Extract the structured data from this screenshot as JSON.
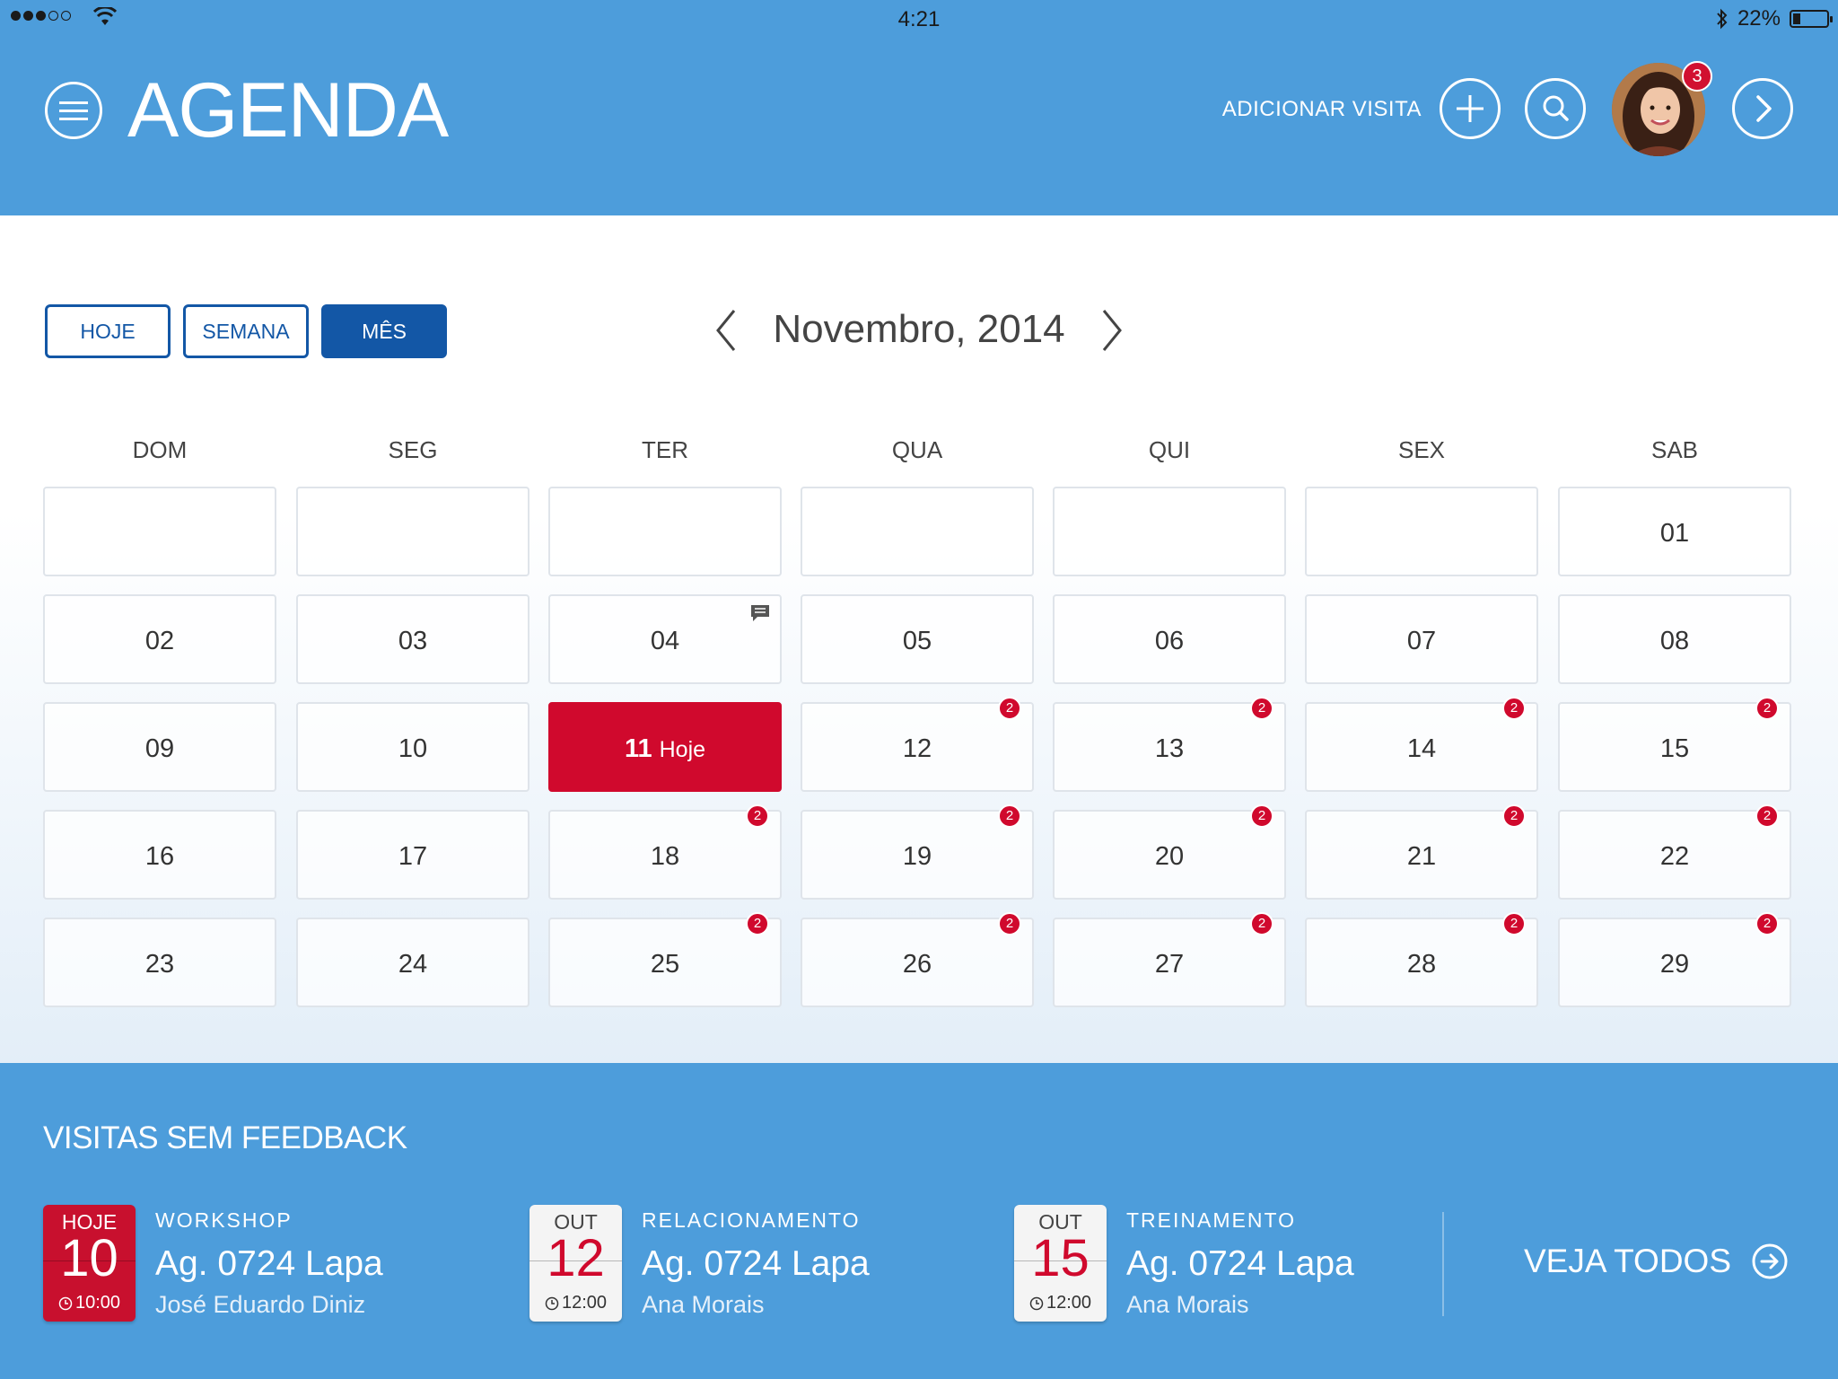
{
  "status_bar": {
    "time": "4:21",
    "battery": "22%",
    "battery_fraction": 0.22
  },
  "header": {
    "title": "AGENDA",
    "add_visit_label": "ADICIONAR VISITA",
    "notification_count": "3"
  },
  "calendar": {
    "views": [
      {
        "label": "HOJE",
        "active": false
      },
      {
        "label": "SEMANA",
        "active": false
      },
      {
        "label": "MÊS",
        "active": true
      }
    ],
    "month_label": "Novembro, 2014",
    "weekdays": [
      "DOM",
      "SEG",
      "TER",
      "QUA",
      "QUI",
      "SEX",
      "SAB"
    ],
    "today_label": "Hoje",
    "weeks": [
      [
        null,
        null,
        null,
        null,
        null,
        null,
        {
          "num": "01"
        }
      ],
      [
        {
          "num": "02"
        },
        {
          "num": "03"
        },
        {
          "num": "04",
          "comment": true
        },
        {
          "num": "05"
        },
        {
          "num": "06"
        },
        {
          "num": "07"
        },
        {
          "num": "08"
        }
      ],
      [
        {
          "num": "09"
        },
        {
          "num": "10"
        },
        {
          "num": "11",
          "today": true
        },
        {
          "num": "12",
          "badge": "2"
        },
        {
          "num": "13",
          "badge": "2"
        },
        {
          "num": "14",
          "badge": "2"
        },
        {
          "num": "15",
          "badge": "2"
        }
      ],
      [
        {
          "num": "16"
        },
        {
          "num": "17"
        },
        {
          "num": "18",
          "badge": "2"
        },
        {
          "num": "19",
          "badge": "2"
        },
        {
          "num": "20",
          "badge": "2"
        },
        {
          "num": "21",
          "badge": "2"
        },
        {
          "num": "22",
          "badge": "2"
        }
      ],
      [
        {
          "num": "23"
        },
        {
          "num": "24"
        },
        {
          "num": "25",
          "badge": "2"
        },
        {
          "num": "26",
          "badge": "2"
        },
        {
          "num": "27",
          "badge": "2"
        },
        {
          "num": "28",
          "badge": "2"
        },
        {
          "num": "29",
          "badge": "2"
        }
      ]
    ]
  },
  "feedback": {
    "title": "VISITAS SEM FEEDBACK",
    "visits": [
      {
        "month": "HOJE",
        "day": "10",
        "time": "10:00",
        "type": "WORKSHOP",
        "place": "Ag. 0724 Lapa",
        "person": "José Eduardo Diniz",
        "highlight": true
      },
      {
        "month": "OUT",
        "day": "12",
        "time": "12:00",
        "type": "RELACIONAMENTO",
        "place": "Ag. 0724 Lapa",
        "person": "Ana Morais",
        "highlight": false
      },
      {
        "month": "OUT",
        "day": "15",
        "time": "12:00",
        "type": "TREINAMENTO",
        "place": "Ag. 0724 Lapa",
        "person": "Ana Morais",
        "highlight": false
      }
    ],
    "see_all_label": "VEJA TODOS"
  },
  "colors": {
    "primary_blue": "#4d9ddb",
    "dark_blue": "#1357a6",
    "accent_red": "#d0092d"
  }
}
